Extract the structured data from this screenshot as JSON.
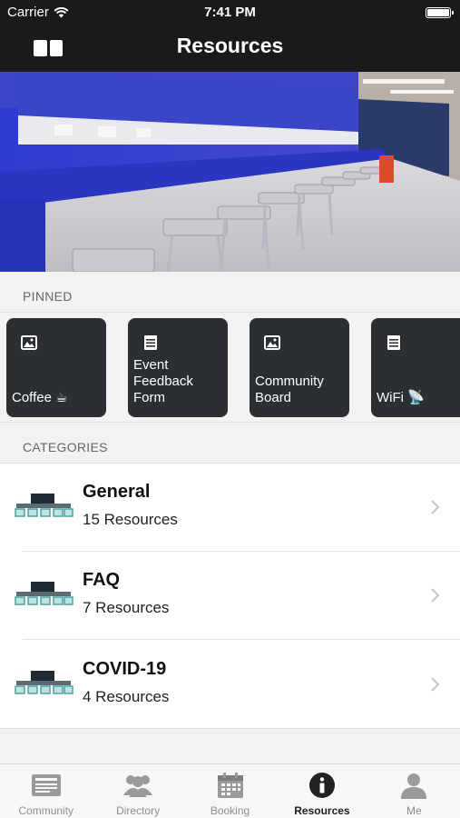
{
  "status": {
    "carrier": "Carrier",
    "time": "7:41 PM"
  },
  "nav": {
    "title": "Resources"
  },
  "pinned": {
    "header": "PINNED",
    "items": [
      {
        "label": "Coffee ☕",
        "icon": "image-icon"
      },
      {
        "label": "Event Feedback Form",
        "icon": "document-icon"
      },
      {
        "label": "Community Board",
        "icon": "image-icon"
      },
      {
        "label": "WiFi 📡",
        "icon": "document-icon"
      }
    ]
  },
  "categories": {
    "header": "CATEGORIES",
    "items": [
      {
        "name": "General",
        "count": "15 Resources"
      },
      {
        "name": "FAQ",
        "count": "7 Resources"
      },
      {
        "name": "COVID-19",
        "count": "4 Resources"
      }
    ]
  },
  "tabs": [
    {
      "label": "Community",
      "icon": "newsfeed-icon",
      "active": false
    },
    {
      "label": "Directory",
      "icon": "people-icon",
      "active": false
    },
    {
      "label": "Booking",
      "icon": "calendar-icon",
      "active": false
    },
    {
      "label": "Resources",
      "icon": "info-icon",
      "active": true
    },
    {
      "label": "Me",
      "icon": "person-icon",
      "active": false
    }
  ]
}
